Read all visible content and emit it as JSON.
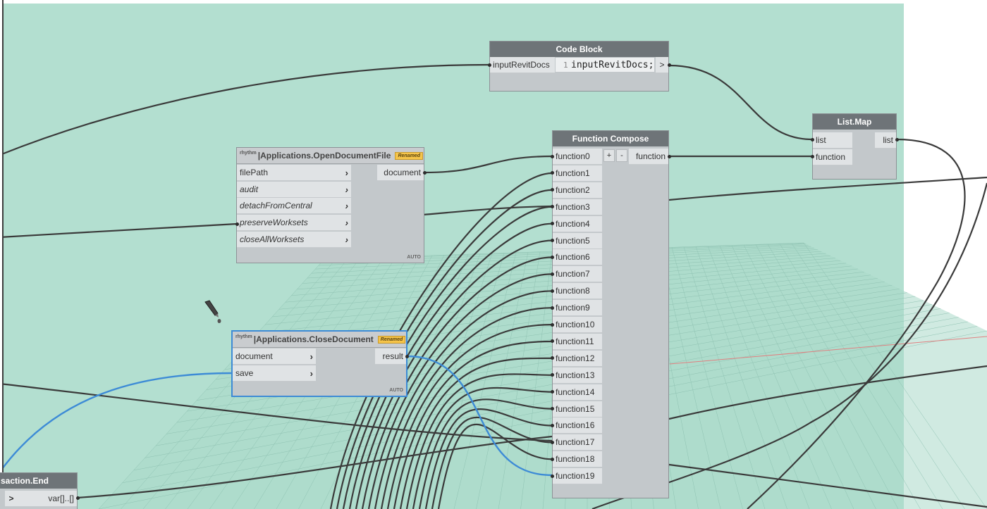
{
  "code_block": {
    "title": "Code Block",
    "input": "inputRevitDocs",
    "line_number": "1",
    "code": "inputRevitDocs;",
    "output": ">"
  },
  "list_map": {
    "title": "List.Map",
    "inputs": [
      "list",
      "function"
    ],
    "output": "list"
  },
  "function_compose": {
    "title": "Function Compose",
    "add_label": "+",
    "remove_label": "-",
    "output": "function",
    "inputs": [
      "function0",
      "function1",
      "function2",
      "function3",
      "function4",
      "function5",
      "function6",
      "function7",
      "function8",
      "function9",
      "function10",
      "function11",
      "function12",
      "function13",
      "function14",
      "function15",
      "function16",
      "function17",
      "function18",
      "function19"
    ]
  },
  "open_document": {
    "prefix": "rhythm",
    "title": "|Applications.OpenDocumentFile",
    "badge": "Renamed",
    "inputs": [
      "filePath",
      "audit",
      "detachFromCentral",
      "preserveWorksets",
      "closeAllWorksets"
    ],
    "output": "document",
    "lacing": "AUTO"
  },
  "close_document": {
    "prefix": "rhythm",
    "title": "|Applications.CloseDocument",
    "badge": "Renamed",
    "inputs": [
      "document",
      "save"
    ],
    "output": "result",
    "lacing": "AUTO"
  },
  "transaction_end": {
    "title": "saction.End",
    "output": "var[]..[]",
    "input_arrow": ">"
  },
  "colors": {
    "group_background": "#b3dfd0",
    "node_header": "#6e7478",
    "selection": "#3d8bd6",
    "wire": "#3a3a3a",
    "badge": "#f5c44a"
  },
  "icons": {
    "cursor": "eyedropper-icon"
  }
}
